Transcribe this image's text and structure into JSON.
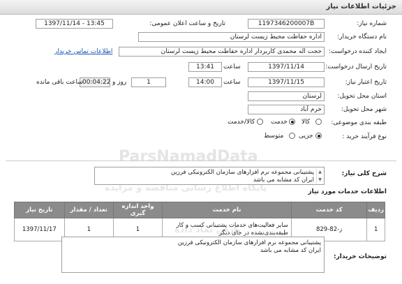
{
  "header": {
    "title": "جزئیات اطلاعات نیاز"
  },
  "fields": {
    "need_number_label": "شماره نیاز:",
    "need_number": "1197346200007B",
    "announce_label": "تاریخ و ساعت اعلان عمومی:",
    "announce_value": "1397/11/14 - 13:45",
    "buyer_label": "نام دستگاه خریدار:",
    "buyer_value": "اداره حفاظت محیط زیست لرستان",
    "creator_label": "ایجاد کننده درخواست:",
    "creator_value": "حجت اله محمدی کاربردار اداره حفاظت محیط زیست لرستان",
    "contact_link": "اطلاعات تماس خریدار",
    "send_date_label": "تاریخ ارسال درخواست:",
    "send_date": "1397/11/14",
    "send_time_label": "ساعت",
    "send_time": "13:41",
    "valid_label": "تاریخ اعتبار نیاز:",
    "valid_date": "1397/11/15",
    "valid_time_label": "ساعت",
    "valid_time": "14:00",
    "days_value": "1",
    "days_label": "روز و",
    "remaining_value": "00:04:22",
    "remaining_label": "ساعت باقی مانده",
    "province_label": "استان محل تحویل:",
    "province_value": "لرستان",
    "city_label": "شهر محل تحویل:",
    "city_value": "خرم آباد",
    "category_label": "طبقه بندی موضوعی:",
    "category_options": [
      "کالا",
      "خدمت",
      "کالا/خدمت"
    ],
    "category_selected": "خدمت",
    "process_label": "نوع فرآیند خرید :",
    "process_options": [
      "جزیی",
      "متوسط"
    ],
    "process_selected": "جزیی"
  },
  "summary": {
    "label": "شرح کلی نیاز:",
    "line1": "پشتیبانی مجموعه نرم افزارهای سازمان الکترونیکی فرزین",
    "line2": "ایران کد مشابه می باشد"
  },
  "services": {
    "title": "اطلاعات خدمات مورد نیاز",
    "columns": [
      "ردیف",
      "کد خدمت",
      "نام خدمت",
      "واحد اندازه گیری",
      "تعداد / مقدار",
      "تاریخ نیاز"
    ],
    "rows": [
      {
        "row": "1",
        "code": "ز-82-829",
        "name_line1": "سایر فعالیت‌های خدمات پشتیبانی کسب و کار",
        "name_line2": "طبقه‌بندی‌نشده در جای دیگر",
        "unit": "1",
        "qty": "1",
        "date": "1397/11/17"
      }
    ]
  },
  "buyer_notes": {
    "label": "توضیحات خریدار:",
    "line1": "پشتیبانی مجموعه نرم افزارهای سازمان الکترونیکی فرزین",
    "line2": "ایران کد مشابه می باشد"
  },
  "watermark": {
    "brand": "ParsNamadData",
    "line1": "پایگاه اطلاع رسانی مناقصه و مزایده",
    "line2": "پارس نماد داده"
  }
}
